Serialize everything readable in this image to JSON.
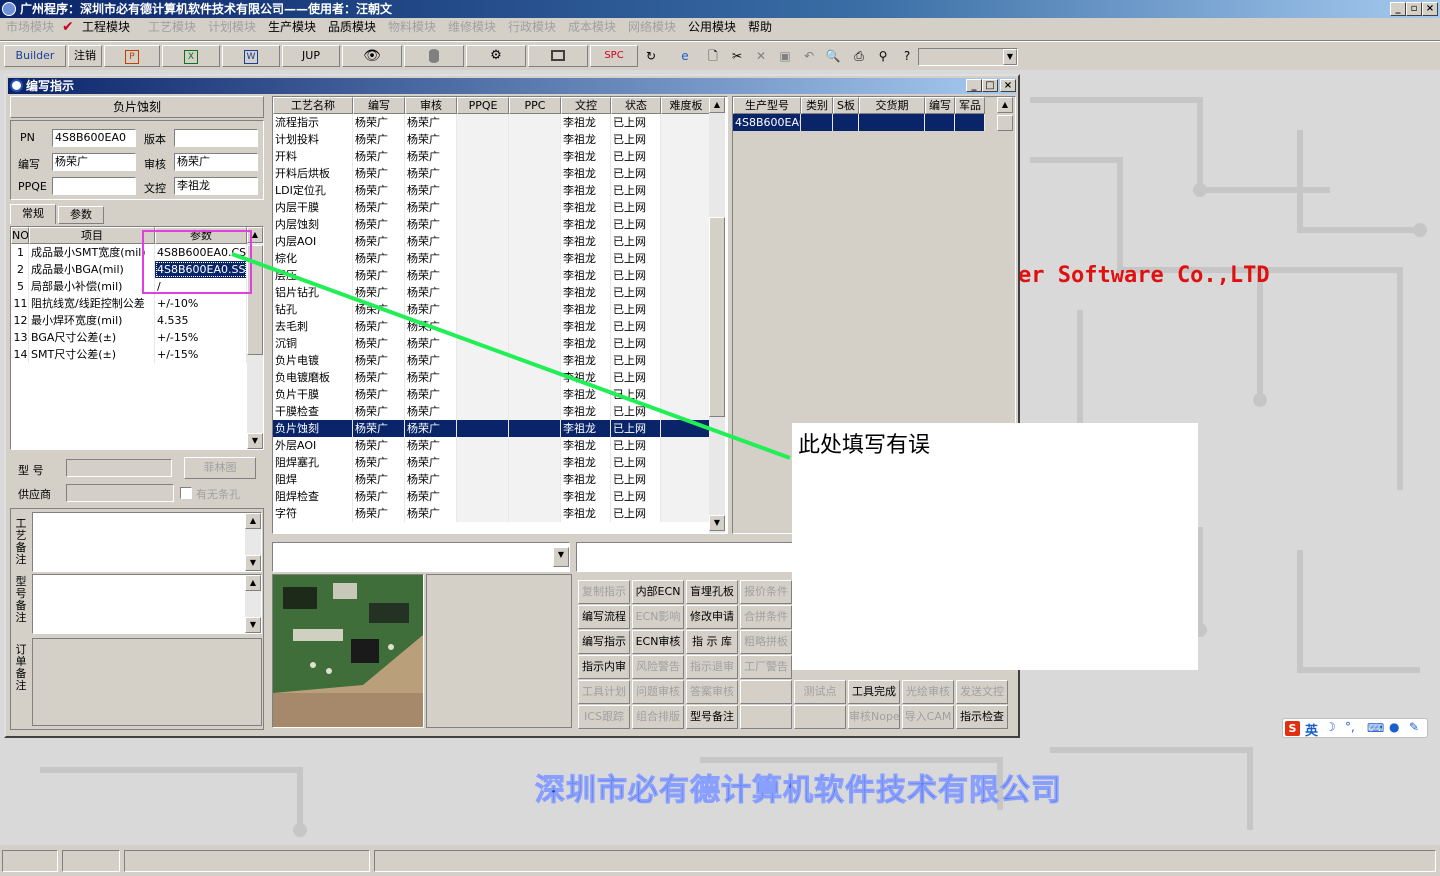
{
  "app": {
    "title": "广州程序：深圳市必有德计算机软件技术有限公司——使用者：汪朝文"
  },
  "menu": [
    "市场模块",
    "工程模块",
    "工艺模块",
    "计划模块",
    "生产模块",
    "品质模块",
    "物料模块",
    "维修模块",
    "行政模块",
    "成本模块",
    "网络模块",
    "公用模块",
    "帮助"
  ],
  "toolbar": {
    "builder": "Builder",
    "logout": "注销",
    "jup": "JUP",
    "spc": "SPC"
  },
  "window": {
    "title": "编写指示"
  },
  "left": {
    "heading": "负片蚀刻",
    "labels": {
      "pn": "PN",
      "version": "版本",
      "writer": "编写",
      "reviewer": "审核",
      "ppqe": "PPQE",
      "doc": "文控"
    },
    "values": {
      "pn": "4S8B600EA0",
      "version": "",
      "writer": "杨荣广",
      "reviewer": "杨荣广",
      "ppqe": "",
      "doc": "李祖龙"
    },
    "tabs": [
      "常规",
      "参数"
    ],
    "param_headers": [
      "NO",
      "项目",
      "参数"
    ],
    "params": [
      {
        "no": "1",
        "item": "成品最小SMT宽度(mil)",
        "value": "4S8B600EA0.CS"
      },
      {
        "no": "2",
        "item": "成品最小BGA(mil)",
        "value": "4S8B600EA0.SS"
      },
      {
        "no": "5",
        "item": "局部最小补偿(mil)",
        "value": "/"
      },
      {
        "no": "11",
        "item": "阻抗线宽/线距控制公差",
        "value": "+/-10%"
      },
      {
        "no": "12",
        "item": "最小焊环宽度(mil)",
        "value": "4.535"
      },
      {
        "no": "13",
        "item": "BGA尺寸公差(±)",
        "value": "+/-15%"
      },
      {
        "no": "14",
        "item": "SMT尺寸公差(±)",
        "value": "+/-15%"
      }
    ],
    "model_label": "型 号",
    "supplier_label": "供应商",
    "film_button": "菲林图",
    "checkbox_label": "有无条孔",
    "remark_labels": [
      "工艺备注",
      "型号备注",
      "订单备注"
    ]
  },
  "process_table": {
    "headers": [
      "工艺名称",
      "编写",
      "审核",
      "PPQE",
      "PPC",
      "文控",
      "状态",
      "难度板"
    ],
    "rows": [
      [
        "流程指示",
        "杨荣广",
        "杨荣广",
        "",
        "",
        "李祖龙",
        "已上网"
      ],
      [
        "计划投料",
        "杨荣广",
        "杨荣广",
        "",
        "",
        "李祖龙",
        "已上网"
      ],
      [
        "开料",
        "杨荣广",
        "杨荣广",
        "",
        "",
        "李祖龙",
        "已上网"
      ],
      [
        "开料后烘板",
        "杨荣广",
        "杨荣广",
        "",
        "",
        "李祖龙",
        "已上网"
      ],
      [
        "LDI定位孔",
        "杨荣广",
        "杨荣广",
        "",
        "",
        "李祖龙",
        "已上网"
      ],
      [
        "内层干膜",
        "杨荣广",
        "杨荣广",
        "",
        "",
        "李祖龙",
        "已上网"
      ],
      [
        "内层蚀刻",
        "杨荣广",
        "杨荣广",
        "",
        "",
        "李祖龙",
        "已上网"
      ],
      [
        "内层AOI",
        "杨荣广",
        "杨荣广",
        "",
        "",
        "李祖龙",
        "已上网"
      ],
      [
        "棕化",
        "杨荣广",
        "杨荣广",
        "",
        "",
        "李祖龙",
        "已上网"
      ],
      [
        "层压",
        "杨荣广",
        "杨荣广",
        "",
        "",
        "李祖龙",
        "已上网"
      ],
      [
        "铝片钻孔",
        "杨荣广",
        "杨荣广",
        "",
        "",
        "李祖龙",
        "已上网"
      ],
      [
        "钻孔",
        "杨荣广",
        "杨荣广",
        "",
        "",
        "李祖龙",
        "已上网"
      ],
      [
        "去毛刺",
        "杨荣广",
        "杨荣广",
        "",
        "",
        "李祖龙",
        "已上网"
      ],
      [
        "沉铜",
        "杨荣广",
        "杨荣广",
        "",
        "",
        "李祖龙",
        "已上网"
      ],
      [
        "负片电镀",
        "杨荣广",
        "杨荣广",
        "",
        "",
        "李祖龙",
        "已上网"
      ],
      [
        "负电镀磨板",
        "杨荣广",
        "杨荣广",
        "",
        "",
        "李祖龙",
        "已上网"
      ],
      [
        "负片干膜",
        "杨荣广",
        "杨荣广",
        "",
        "",
        "李祖龙",
        "已上网"
      ],
      [
        "干膜检查",
        "杨荣广",
        "杨荣广",
        "",
        "",
        "李祖龙",
        "已上网"
      ],
      [
        "负片蚀刻",
        "杨荣广",
        "杨荣广",
        "",
        "",
        "李祖龙",
        "已上网"
      ],
      [
        "外层AOI",
        "杨荣广",
        "杨荣广",
        "",
        "",
        "李祖龙",
        "已上网"
      ],
      [
        "阻焊塞孔",
        "杨荣广",
        "杨荣广",
        "",
        "",
        "李祖龙",
        "已上网"
      ],
      [
        "阻焊",
        "杨荣广",
        "杨荣广",
        "",
        "",
        "李祖龙",
        "已上网"
      ],
      [
        "阻焊检查",
        "杨荣广",
        "杨荣广",
        "",
        "",
        "李祖龙",
        "已上网"
      ],
      [
        "字符",
        "杨荣广",
        "杨荣广",
        "",
        "",
        "李祖龙",
        "已上网"
      ]
    ],
    "selected_row": "负片蚀刻"
  },
  "model_table": {
    "headers": [
      "生产型号",
      "类别",
      "S板",
      "交货期",
      "编写",
      "军品"
    ],
    "rows": [
      [
        "4S8B600EA0",
        "",
        "",
        "",
        "",
        ""
      ]
    ]
  },
  "buttons": [
    [
      "复制指示",
      "内部ECN",
      "盲埋孔板",
      "报价条件"
    ],
    [
      "编写流程",
      "ECN影响",
      "修改申请",
      "合拼条件"
    ],
    [
      "编写指示",
      "ECN审核",
      "指 示 库",
      "粗略拼板"
    ],
    [
      "指示内审",
      "风险警告",
      "指示退审",
      "工厂警告"
    ],
    [
      "工具计划",
      "问题审核",
      "答案审核",
      "",
      "测试点",
      "工具完成",
      "光绘审核",
      "发送文控"
    ],
    [
      "ICS跟踪",
      "组合排版",
      "型号备注",
      "",
      "",
      "审核Nope",
      "导入CAM",
      "指示检查"
    ]
  ],
  "buttons_disabled": [
    "复制指示",
    "报价条件",
    "ECN影响",
    "合拼条件",
    "粗略拼板",
    "风险警告",
    "指示退审",
    "工厂警告",
    "工具计划",
    "问题审核",
    "答案审核",
    "测试点",
    "光绘审核",
    "发送文控",
    "ICS跟踪",
    "组合排版",
    "审核Nope",
    "导入CAM"
  ],
  "annotation": {
    "text": "此处填写有误",
    "arrow_color": "#22ee55",
    "highlight_color": "#e040e0"
  },
  "background": {
    "slogan_en": "er Software Co.,LTD",
    "slogan_cn": "深圳市必有德计算机软件技术有限公司"
  },
  "ime": {
    "lang": "英"
  }
}
